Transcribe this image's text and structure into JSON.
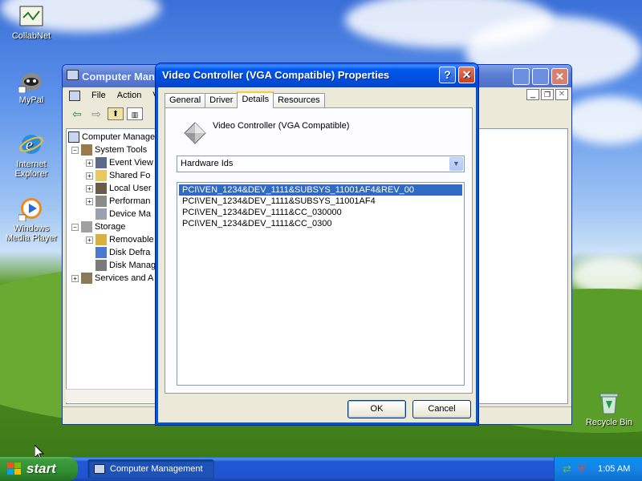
{
  "desktop": {
    "icons": [
      {
        "label": "CollabNet"
      },
      {
        "label": "MyPal"
      },
      {
        "label": "Internet Explorer"
      },
      {
        "label": "Windows Media Player"
      },
      {
        "label": "Recycle Bin"
      }
    ]
  },
  "computer_management": {
    "title": "Computer Management",
    "menu": [
      "File",
      "Action",
      "Vi"
    ],
    "tree": [
      {
        "label": "Computer Manage",
        "indent": 0
      },
      {
        "label": "System Tools",
        "indent": 1
      },
      {
        "label": "Event View",
        "indent": 2
      },
      {
        "label": "Shared Fo",
        "indent": 2
      },
      {
        "label": "Local User",
        "indent": 2
      },
      {
        "label": "Performan",
        "indent": 2
      },
      {
        "label": "Device Ma",
        "indent": 2
      },
      {
        "label": "Storage",
        "indent": 1
      },
      {
        "label": "Removable",
        "indent": 2
      },
      {
        "label": "Disk Defra",
        "indent": 2
      },
      {
        "label": "Disk Manag",
        "indent": 2
      },
      {
        "label": "Services and A",
        "indent": 1
      }
    ]
  },
  "dialog": {
    "title": "Video Controller (VGA Compatible) Properties",
    "help_label": "?",
    "close_label": "✕",
    "tabs": [
      "General",
      "Driver",
      "Details",
      "Resources"
    ],
    "active_tab": "Details",
    "device_name": "Video Controller (VGA Compatible)",
    "property_combo": {
      "selected": "Hardware Ids"
    },
    "values": [
      "PCI\\VEN_1234&DEV_1111&SUBSYS_11001AF4&REV_00",
      "PCI\\VEN_1234&DEV_1111&SUBSYS_11001AF4",
      "PCI\\VEN_1234&DEV_1111&CC_030000",
      "PCI\\VEN_1234&DEV_1111&CC_0300"
    ],
    "selected_index": 0,
    "ok_label": "OK",
    "cancel_label": "Cancel"
  },
  "taskbar": {
    "start_label": "start",
    "task_label": "Computer Management",
    "clock": "1:05 AM"
  },
  "colors": {
    "dialog_title": "#0054e3",
    "selection": "#316ac5",
    "start_green": "#3e9b3e"
  }
}
